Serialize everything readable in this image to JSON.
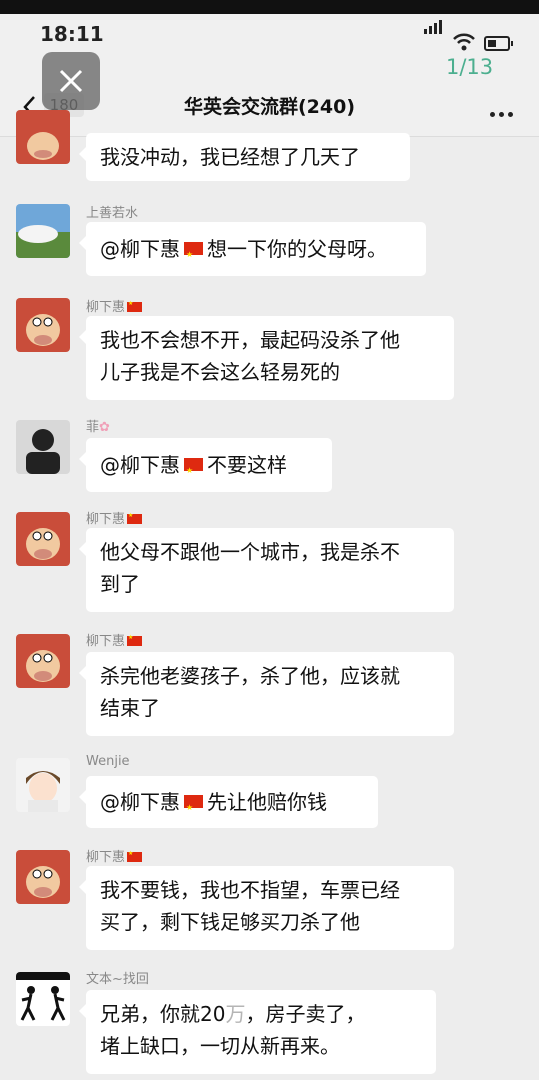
{
  "status": {
    "time": "18:11",
    "pager": "1/13"
  },
  "nav": {
    "back_count": "180",
    "title": "华英会交流群(240)"
  },
  "messages": [
    {
      "sender": "",
      "text": "我没冲动，我已经想了几天了"
    },
    {
      "sender": "上善若水",
      "mention": "@柳下惠",
      "text": "想一下你的父母呀。"
    },
    {
      "sender": "柳下惠",
      "line1": "我也不会想不开，最起码没杀了他",
      "line2": "儿子我是不会这么轻易死的"
    },
    {
      "sender": "菲",
      "mention": "@柳下惠",
      "text": "不要这样"
    },
    {
      "sender": "柳下惠",
      "line1": "他父母不跟他一个城市，我是杀不",
      "line2": "到了"
    },
    {
      "sender": "柳下惠",
      "line1": "杀完他老婆孩子，杀了他，应该就",
      "line2": "结束了"
    },
    {
      "sender": "Wenjie",
      "mention": "@柳下惠",
      "text": "先让他赔你钱"
    },
    {
      "sender": "柳下惠",
      "line1": "我不要钱，我也不指望，车票已经",
      "line2": "买了，剩下钱足够买刀杀了他"
    },
    {
      "sender": "文本~找回",
      "line1a": "兄弟，你就",
      "line1b": "20",
      "line1c": "万",
      "line1d": "，房子卖了，",
      "line2": "堵上缺口，一切从新再来。"
    }
  ],
  "colors": {
    "flag_red": "#de2910",
    "flag_star": "#ffde00",
    "pager_text": "#4caf8f"
  }
}
